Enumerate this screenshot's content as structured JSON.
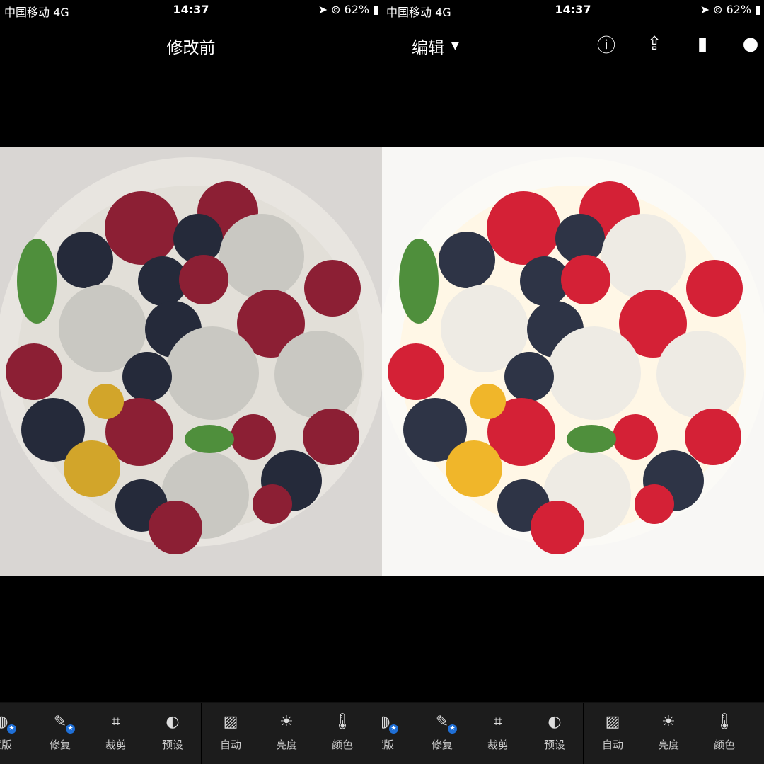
{
  "status": {
    "carrier": "中国移动  4G",
    "time": "14:37",
    "battery": "62%"
  },
  "left": {
    "title": "修改前"
  },
  "right": {
    "title": "编辑",
    "icons": [
      "help-icon",
      "share-icon",
      "compare-icon",
      "more-icon"
    ]
  },
  "toolbar": {
    "items": [
      {
        "label": "蒙版",
        "icon": "mask-icon",
        "premium": true
      },
      {
        "label": "修复",
        "icon": "heal-icon",
        "premium": true
      },
      {
        "label": "裁剪",
        "icon": "crop-icon"
      },
      {
        "label": "预设",
        "icon": "presets-icon"
      },
      {
        "label": "自动",
        "icon": "auto-icon"
      },
      {
        "label": "亮度",
        "icon": "brightness-icon"
      },
      {
        "label": "颜色",
        "icon": "color-icon"
      }
    ]
  }
}
